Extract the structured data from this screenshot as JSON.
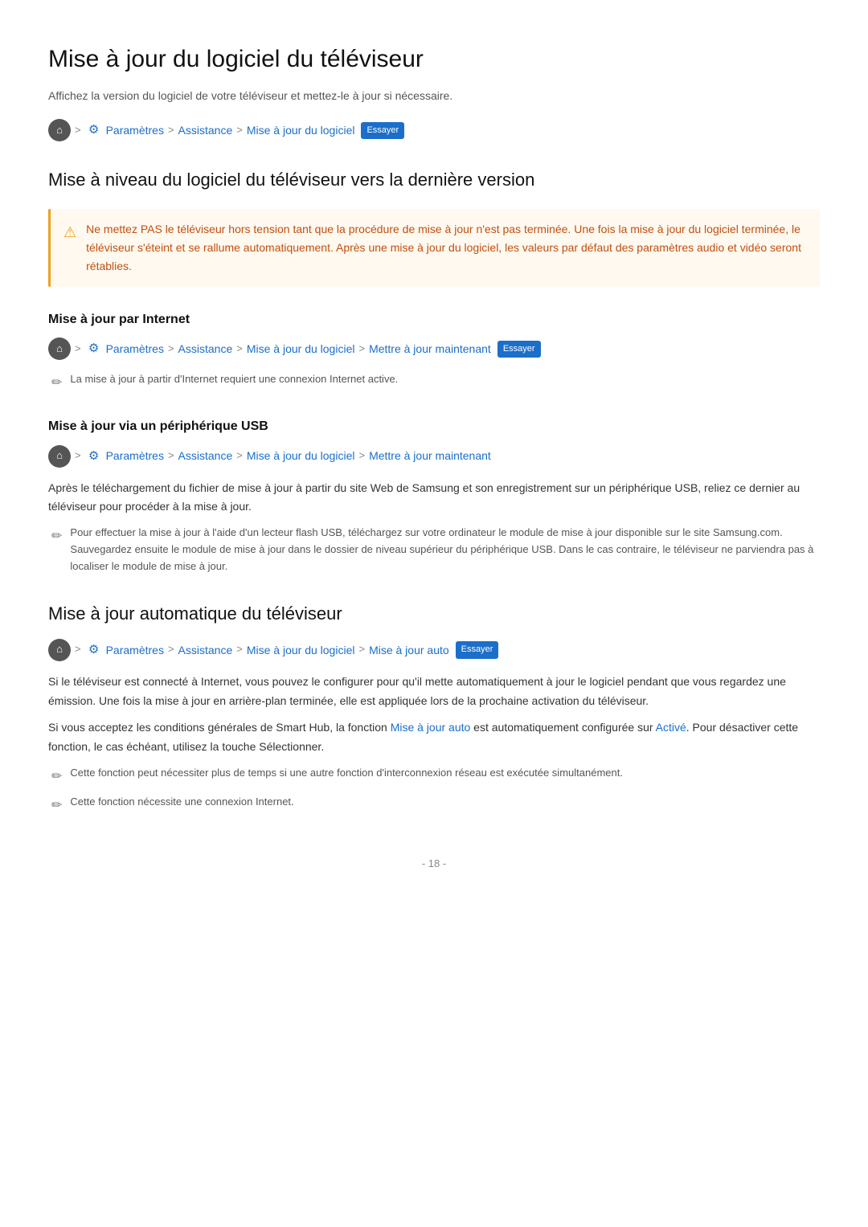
{
  "page": {
    "title": "Mise à jour du logiciel du téléviseur",
    "subtitle": "Affichez la version du logiciel de votre téléviseur et mettez-le à jour si nécessaire.",
    "footer": "- 18 -"
  },
  "breadcrumbs": {
    "b1": {
      "home_icon": "⌂",
      "separator1": ">",
      "gear_icon": "⚙",
      "paramètres": "Paramètres",
      "separator2": ">",
      "assistance": "Assistance",
      "separator3": ">",
      "logiciel": "Mise à jour du logiciel",
      "badge": "Essayer"
    },
    "b2": {
      "home_icon": "⌂",
      "separator1": ">",
      "gear_icon": "⚙",
      "paramètres": "Paramètres",
      "separator2": ">",
      "assistance": "Assistance",
      "separator3": ">",
      "logiciel": "Mise à jour du logiciel",
      "separator4": ">",
      "maintenant": "Mettre à jour maintenant",
      "badge": "Essayer"
    },
    "b3": {
      "home_icon": "⌂",
      "separator1": ">",
      "gear_icon": "⚙",
      "paramètres": "Paramètres",
      "separator2": ">",
      "assistance": "Assistance",
      "separator3": ">",
      "logiciel": "Mise à jour du logiciel",
      "separator4": ">",
      "maintenant": "Mettre à jour maintenant"
    },
    "b4": {
      "home_icon": "⌂",
      "separator1": ">",
      "gear_icon": "⚙",
      "paramètres": "Paramètres",
      "separator2": ">",
      "assistance": "Assistance",
      "separator3": ">",
      "logiciel": "Mise à jour du logiciel",
      "separator4": ">",
      "auto": "Mise à jour auto",
      "badge": "Essayer"
    }
  },
  "section1": {
    "heading": "Mise à niveau du logiciel du téléviseur vers la dernière version",
    "warning": "Ne mettez PAS le téléviseur hors tension tant que la procédure de mise à jour n'est pas terminée. Une fois la mise à jour du logiciel terminée, le téléviseur s'éteint et se rallume automatiquement. Après une mise à jour du logiciel, les valeurs par défaut des paramètres audio et vidéo seront rétablies."
  },
  "section2": {
    "heading": "Mise à jour par Internet",
    "note": "La mise à jour à partir d'Internet requiert une connexion Internet active."
  },
  "section3": {
    "heading": "Mise à jour via un périphérique USB",
    "body1": "Après le téléchargement du fichier de mise à jour à partir du site Web de Samsung et son enregistrement sur un périphérique USB, reliez ce dernier au téléviseur pour procéder à la mise à jour.",
    "note": "Pour effectuer la mise à jour à l'aide d'un lecteur flash USB, téléchargez sur votre ordinateur le module de mise à jour disponible sur le site Samsung.com. Sauvegardez ensuite le module de mise à jour dans le dossier de niveau supérieur du périphérique USB. Dans le cas contraire, le téléviseur ne parviendra pas à localiser le module de mise à jour."
  },
  "section4": {
    "heading": "Mise à jour automatique du téléviseur",
    "body1": "Si le téléviseur est connecté à Internet, vous pouvez le configurer pour qu'il mette automatiquement à jour le logiciel pendant que vous regardez une émission. Une fois la mise à jour en arrière-plan terminée, elle est appliquée lors de la prochaine activation du téléviseur.",
    "body2_part1": "Si vous acceptez les conditions générales de Smart Hub, la fonction ",
    "body2_link": "Mise à jour auto",
    "body2_part2": " est automatiquement configurée sur ",
    "body2_activé": "Activé",
    "body2_part3": ". Pour désactiver cette fonction, le cas échéant, utilisez la touche Sélectionner.",
    "note1": "Cette fonction peut nécessiter plus de temps si une autre fonction d'interconnexion réseau est exécutée simultanément.",
    "note2": "Cette fonction nécessite une connexion Internet."
  }
}
